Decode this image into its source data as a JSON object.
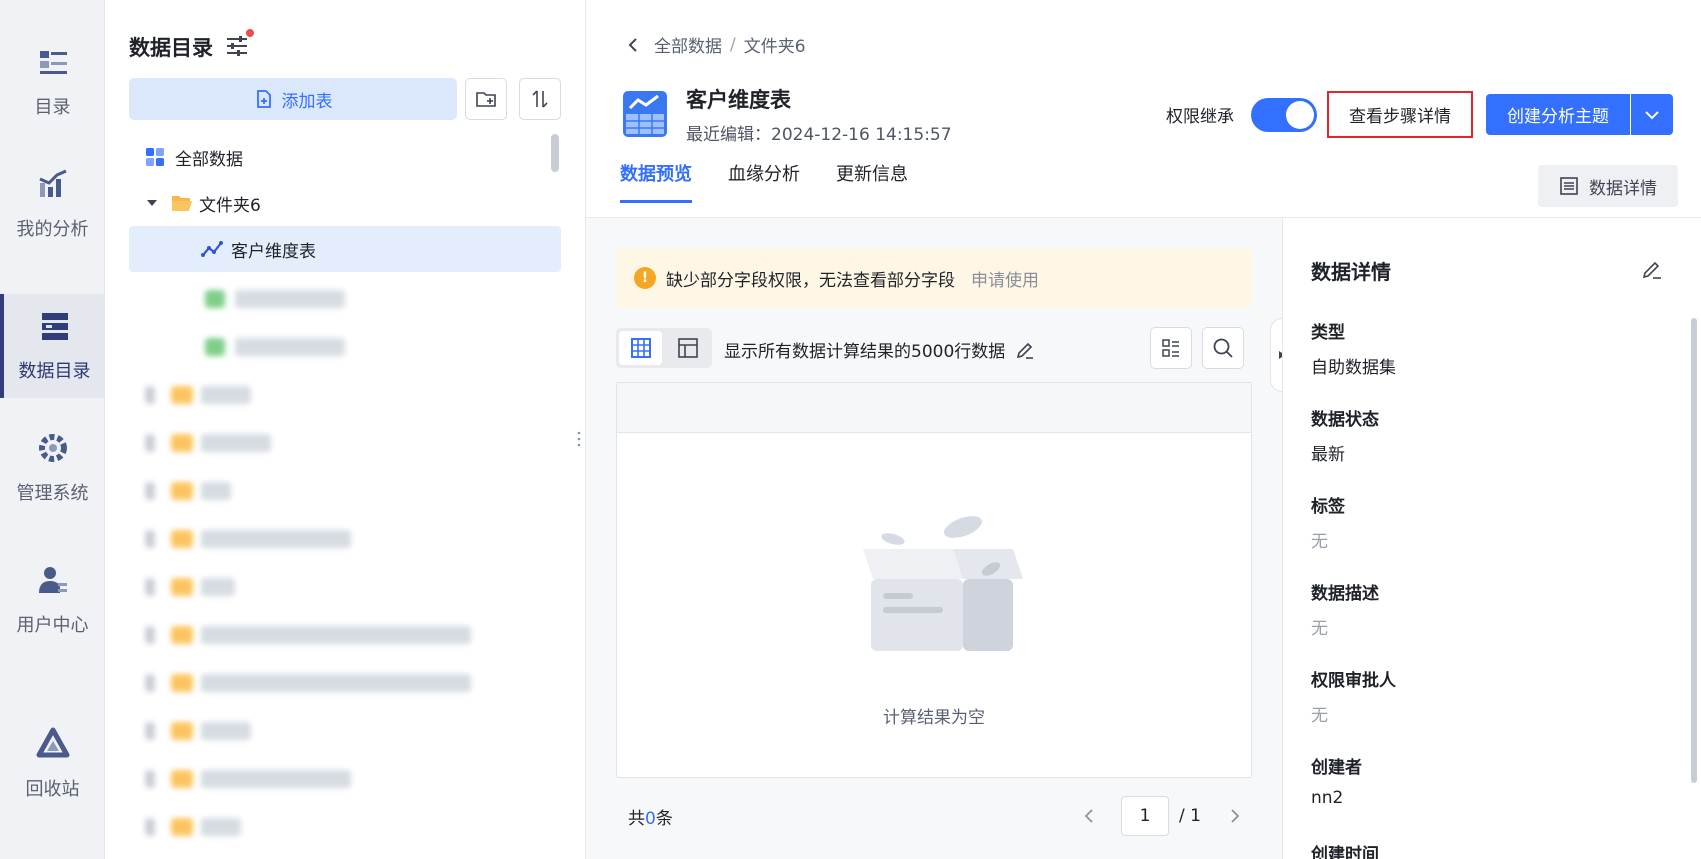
{
  "nav": {
    "items": [
      {
        "label": "目录",
        "icon": "catalog-icon"
      },
      {
        "label": "我的分析",
        "icon": "analysis-chart-icon"
      },
      {
        "label": "数据目录",
        "icon": "database-icon"
      },
      {
        "label": "管理系统",
        "icon": "gear-icon"
      },
      {
        "label": "用户中心",
        "icon": "user-icon"
      },
      {
        "label": "回收站",
        "icon": "recycle-icon"
      }
    ],
    "active_index": 2
  },
  "tree": {
    "title": "数据目录",
    "add_table_label": "添加表",
    "items": [
      {
        "label": "全部数据",
        "icon": "grid-apps-icon"
      },
      {
        "label": "文件夹6",
        "icon": "folder-open-icon"
      },
      {
        "label": "客户维度表",
        "icon": "line-chart-icon",
        "selected": true
      }
    ]
  },
  "main": {
    "breadcrumb": [
      "全部数据",
      "文件夹6"
    ],
    "table_name": "客户维度表",
    "last_edit": "最近编辑：2024-12-16 14:15:57",
    "permission_label": "权限继承",
    "permission_on": true,
    "view_steps_label": "查看步骤详情",
    "create_topic_label": "创建分析主题",
    "tabs": [
      "数据预览",
      "血缘分析",
      "更新信息"
    ],
    "active_tab": 0,
    "data_detail_btn": "数据详情"
  },
  "preview": {
    "warning_text": "缺少部分字段权限，无法查看部分字段",
    "warning_link": "申请使用",
    "rows_info": "显示所有数据计算结果的5000行数据",
    "empty_text": "计算结果为空",
    "total_prefix": "共",
    "total_count": "0",
    "total_suffix": "条",
    "page_current": "1",
    "page_total": "/ 1"
  },
  "details": {
    "title": "数据详情",
    "fields": [
      {
        "label": "类型",
        "value": "自助数据集",
        "muted": false
      },
      {
        "label": "数据状态",
        "value": "最新",
        "muted": false
      },
      {
        "label": "标签",
        "value": "无",
        "muted": true
      },
      {
        "label": "数据描述",
        "value": "无",
        "muted": true
      },
      {
        "label": "权限审批人",
        "value": "无",
        "muted": true
      },
      {
        "label": "创建者",
        "value": "nn2",
        "muted": false
      },
      {
        "label": "创建时间",
        "value": "",
        "muted": false
      }
    ]
  },
  "colors": {
    "accent": "#3370ff",
    "highlight_border": "#e3262d",
    "warning_bg": "#fff7e6",
    "warning_icon": "#f5a623"
  }
}
